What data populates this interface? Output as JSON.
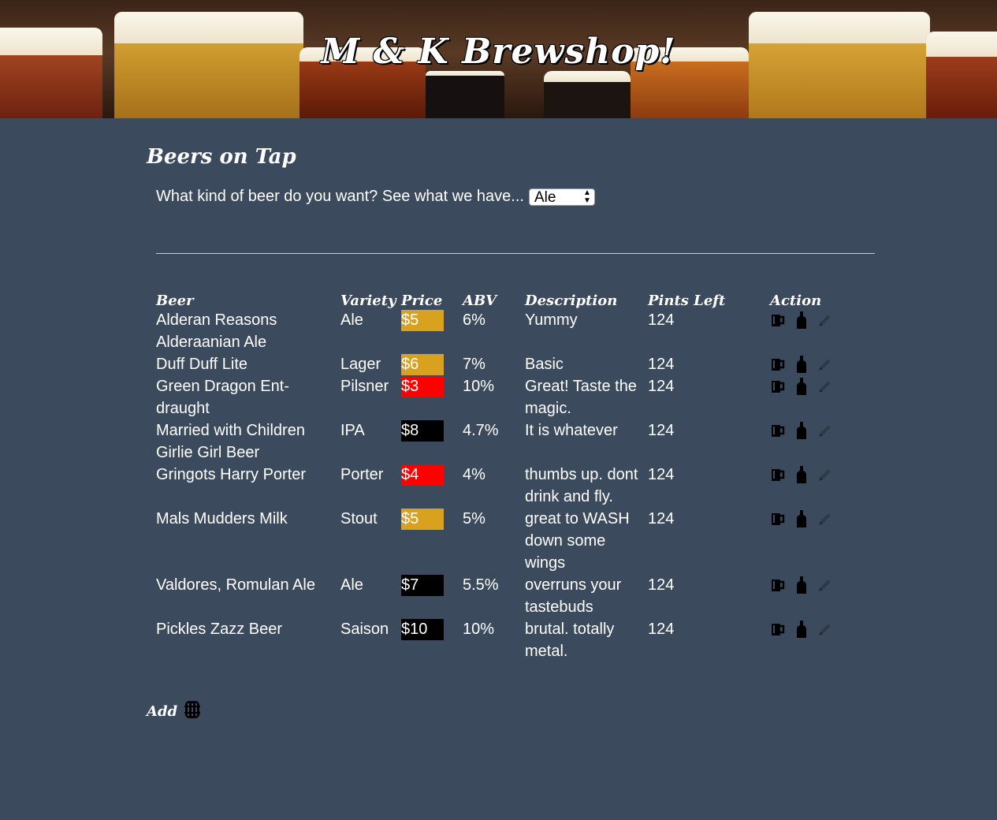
{
  "header": {
    "title": "M & K Brewshop!"
  },
  "section": {
    "title": "Beers on Tap"
  },
  "filter": {
    "prompt": "What kind of beer do you want? See what we have...",
    "selected": "Ale"
  },
  "table": {
    "columns": [
      "Beer",
      "Variety",
      "Price",
      "ABV",
      "Description",
      "Pints Left",
      "Action"
    ],
    "rows": [
      {
        "beer": "Alderan Reasons Alderaanian Ale",
        "variety": "Ale",
        "price": "$5",
        "price_color": "#d9a21e",
        "abv": "6%",
        "description": "Yummy",
        "pints": "124"
      },
      {
        "beer": "Duff Duff Lite",
        "variety": "Lager",
        "price": "$6",
        "price_color": "#d9a21e",
        "abv": "7%",
        "description": "Basic",
        "pints": "124"
      },
      {
        "beer": "Green Dragon Ent-draught",
        "variety": "Pilsner",
        "price": "$3",
        "price_color": "#ff0000",
        "abv": "10%",
        "description": "Great! Taste the magic.",
        "pints": "124"
      },
      {
        "beer": "Married with Children Girlie Girl Beer",
        "variety": "IPA",
        "price": "$8",
        "price_color": "#000000",
        "abv": "4.7%",
        "description": "It is whatever",
        "pints": "124"
      },
      {
        "beer": "Gringots Harry Porter",
        "variety": "Porter",
        "price": "$4",
        "price_color": "#ff0000",
        "abv": "4%",
        "description": "thumbs up. dont drink and fly.",
        "pints": "124"
      },
      {
        "beer": "Mals Mudders Milk",
        "variety": "Stout",
        "price": "$5",
        "price_color": "#d9a21e",
        "abv": "5%",
        "description": "great to WASH down some wings",
        "pints": "124"
      },
      {
        "beer": "Valdores, Romulan Ale",
        "variety": "Ale",
        "price": "$7",
        "price_color": "#000000",
        "abv": "5.5%",
        "description": "overruns your tastebuds",
        "pints": "124"
      },
      {
        "beer": "Pickles Zazz Beer",
        "variety": "Saison",
        "price": "$10",
        "price_color": "#000000",
        "abv": "10%",
        "description": "brutal. totally metal.",
        "pints": "124"
      }
    ],
    "action_icons": [
      "beer-mug-icon",
      "bottle-icon",
      "pencil-icon"
    ]
  },
  "add": {
    "label": "Add",
    "icon": "barrel-icon"
  },
  "colors": {
    "background": "#3c4a5d",
    "gold": "#d9a21e",
    "red": "#ff0000",
    "black": "#000000"
  }
}
